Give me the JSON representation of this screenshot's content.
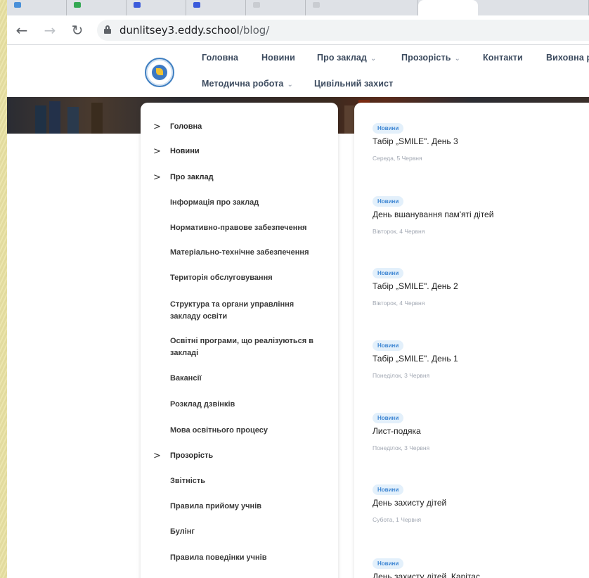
{
  "browser": {
    "url_host": "dunlitsey3.eddy.school",
    "url_path": "/blog/"
  },
  "nav": {
    "row1": [
      {
        "label": "Головна"
      },
      {
        "label": "Новини"
      },
      {
        "label": "Про заклад",
        "chevron": true
      },
      {
        "label": "Прозорість",
        "chevron": true
      },
      {
        "label": "Контакти"
      },
      {
        "label": "Виховна ро"
      }
    ],
    "row2": [
      {
        "label": "Методична робота",
        "chevron": true
      },
      {
        "label": "Цивільний захист"
      }
    ]
  },
  "sidemenu": {
    "items": [
      {
        "label": "Головна",
        "arrow": ">"
      },
      {
        "label": "Новини",
        "arrow": ">"
      },
      {
        "label": "Про заклад",
        "arrow": ">"
      },
      {
        "label": "Інформація про заклад"
      },
      {
        "label": "Нормативно-правове забезпечення"
      },
      {
        "label": "Матеріально-технічне забезпечення"
      },
      {
        "label": "Територія обслуговування"
      },
      {
        "label": "Структура та органи управління закладу освіти"
      },
      {
        "label": "Освітні програми, що реалізуються в закладі"
      },
      {
        "label": "Вакансії"
      },
      {
        "label": "Розклад дзвінків"
      },
      {
        "label": "Мова освітнього процесу"
      },
      {
        "label": "Прозорість",
        "arrow": ">"
      },
      {
        "label": "Звітність"
      },
      {
        "label": "Правила прийому учнів"
      },
      {
        "label": "Булінг"
      },
      {
        "label": "Правила поведінки учнів"
      }
    ]
  },
  "feed": {
    "posts": [
      {
        "badge": "Новини",
        "title": "Табір „SMILE\". День 3",
        "date": "Середа, 5 Червня"
      },
      {
        "badge": "Новини",
        "title": "День вшанування пам'яті дітей",
        "date": "Вівторок, 4 Червня"
      },
      {
        "badge": "Новини",
        "title": "Табір „SMILE\". День 2",
        "date": "Вівторок, 4 Червня"
      },
      {
        "badge": "Новини",
        "title": "Табір „SMILE\". День 1",
        "date": "Понеділок, 3 Червня"
      },
      {
        "badge": "Новини",
        "title": "Лист-подяка",
        "date": "Понеділок, 3 Червня"
      },
      {
        "badge": "Новини",
        "title": "День захисту дітей",
        "date": "Субота, 1 Червня"
      },
      {
        "badge": "Новини",
        "title": "День захисту дітей. Карітас",
        "date": ""
      }
    ]
  },
  "colors": {
    "accent": "#3e86d3",
    "badge_bg": "#e3f0fb",
    "nav_text": "#3b4a5e",
    "desktop_bg": "#e9e2a3"
  }
}
